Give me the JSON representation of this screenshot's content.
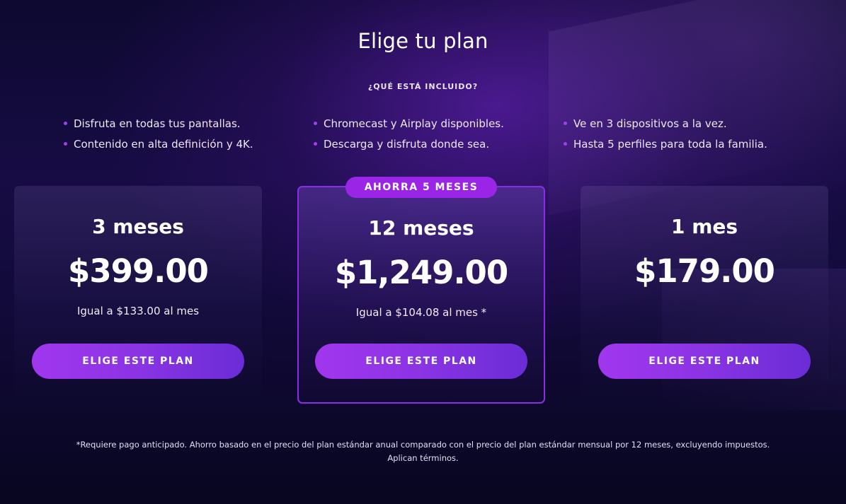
{
  "header": {
    "title": "Elige tu plan"
  },
  "included": {
    "heading": "¿QUÉ ESTÁ INCLUIDO?",
    "columns": [
      [
        "Disfruta en todas tus pantallas.",
        "Contenido en alta definición y 4K."
      ],
      [
        "Chromecast y Airplay disponibles.",
        "Descarga y disfruta donde sea."
      ],
      [
        "Ve en 3 dispositivos a la vez.",
        "Hasta 5 perfiles para toda la familia."
      ]
    ]
  },
  "plans": [
    {
      "duration": "3 meses",
      "price": "$399.00",
      "monthly": "Igual a $133.00 al mes",
      "button": "ELIGE ESTE PLAN"
    },
    {
      "duration": "12 meses",
      "price": "$1,249.00",
      "monthly": "Igual a $104.08 al mes *",
      "button": "ELIGE ESTE PLAN",
      "badge": "AHORRA 5 MESES"
    },
    {
      "duration": "1 mes",
      "price": "$179.00",
      "monthly": "",
      "button": "ELIGE ESTE PLAN"
    }
  ],
  "footnote": {
    "line1": "*Requiere pago anticipado. Ahorro basado en el precio del plan estándar anual comparado con el precio del plan estándar mensual por 12 meses, excluyendo impuestos.",
    "line2": "Aplican términos."
  },
  "colors": {
    "accent": "#9a25e6",
    "button_start": "#a136ee",
    "button_end": "#6a2cd6",
    "bullet": "#a040e8"
  }
}
